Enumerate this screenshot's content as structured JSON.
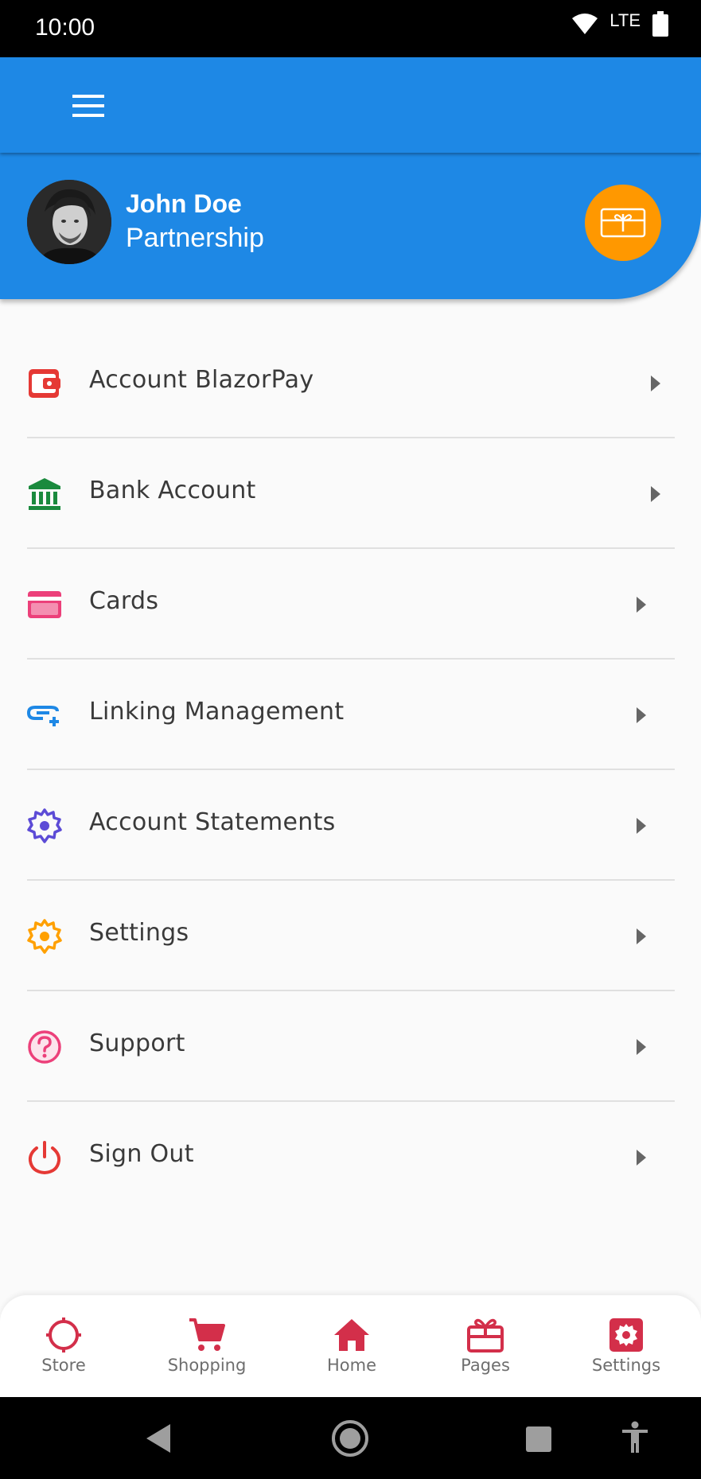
{
  "status_bar": {
    "time": "10:00",
    "network": "LTE"
  },
  "profile": {
    "name": "John Doe",
    "subtitle": "Partnership"
  },
  "menu": [
    {
      "label": "Account BlazorPay",
      "icon": "wallet-icon",
      "color": "#e53935"
    },
    {
      "label": "Bank Account",
      "icon": "bank-icon",
      "color": "#1b8a3e"
    },
    {
      "label": "Cards",
      "icon": "credit-card-icon",
      "color": "#ec407a"
    },
    {
      "label": "Linking Management",
      "icon": "link-add-icon",
      "color": "#1e88e5"
    },
    {
      "label": "Account Statements",
      "icon": "gear-icon",
      "color": "#5c4bd6"
    },
    {
      "label": "Settings",
      "icon": "gear-icon",
      "color": "#ffa000"
    },
    {
      "label": "Support",
      "icon": "help-icon",
      "color": "#ec407a"
    },
    {
      "label": "Sign Out",
      "icon": "power-icon",
      "color": "#e53935"
    }
  ],
  "bottom_nav": [
    {
      "label": "Store",
      "icon": "crosshair-icon"
    },
    {
      "label": "Shopping",
      "icon": "cart-icon"
    },
    {
      "label": "Home",
      "icon": "home-icon"
    },
    {
      "label": "Pages",
      "icon": "gift-icon"
    },
    {
      "label": "Settings",
      "icon": "settings-icon"
    }
  ],
  "colors": {
    "primary": "#1e88e5",
    "accent": "#ff9800",
    "nav_icon": "#d32f4a",
    "background": "#fafafa"
  }
}
